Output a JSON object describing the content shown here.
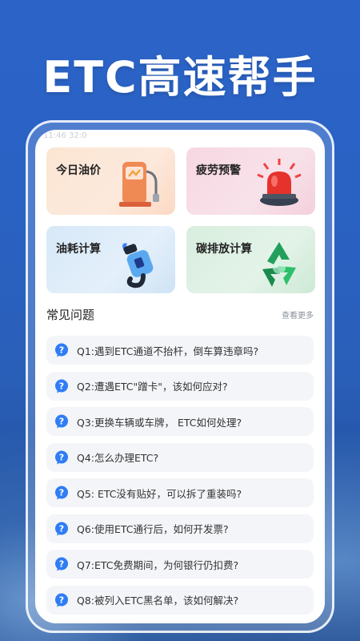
{
  "header": {
    "title": "ETC高速帮手"
  },
  "status_ghost": "11:46 32:0",
  "features": [
    {
      "label": "今日油价",
      "icon": "gas-pump-icon"
    },
    {
      "label": "疲劳预警",
      "icon": "alarm-light-icon"
    },
    {
      "label": "油耗计算",
      "icon": "fuel-nozzle-icon"
    },
    {
      "label": "碳排放计算",
      "icon": "recycle-icon"
    }
  ],
  "faq": {
    "title": "常见问题",
    "more_label": "查看更多",
    "items": [
      "Q1:遇到ETC通道不抬杆，倒车算违章吗?",
      "Q2:遭遇ETC\"蹭卡\"，该如何应对?",
      "Q3:更换车辆或车牌， ETC如何处理?",
      "Q4:怎么办理ETC?",
      "Q5: ETC没有贴好，可以拆了重装吗?",
      "Q6:使用ETC通行后，如何开发票?",
      "Q7:ETC免费期间，为何银行仍扣费?",
      "Q8:被列入ETC黑名单，该如何解决?"
    ]
  },
  "colors": {
    "accent": "#2f7cf6",
    "brand_bg": "#2b63c7"
  }
}
